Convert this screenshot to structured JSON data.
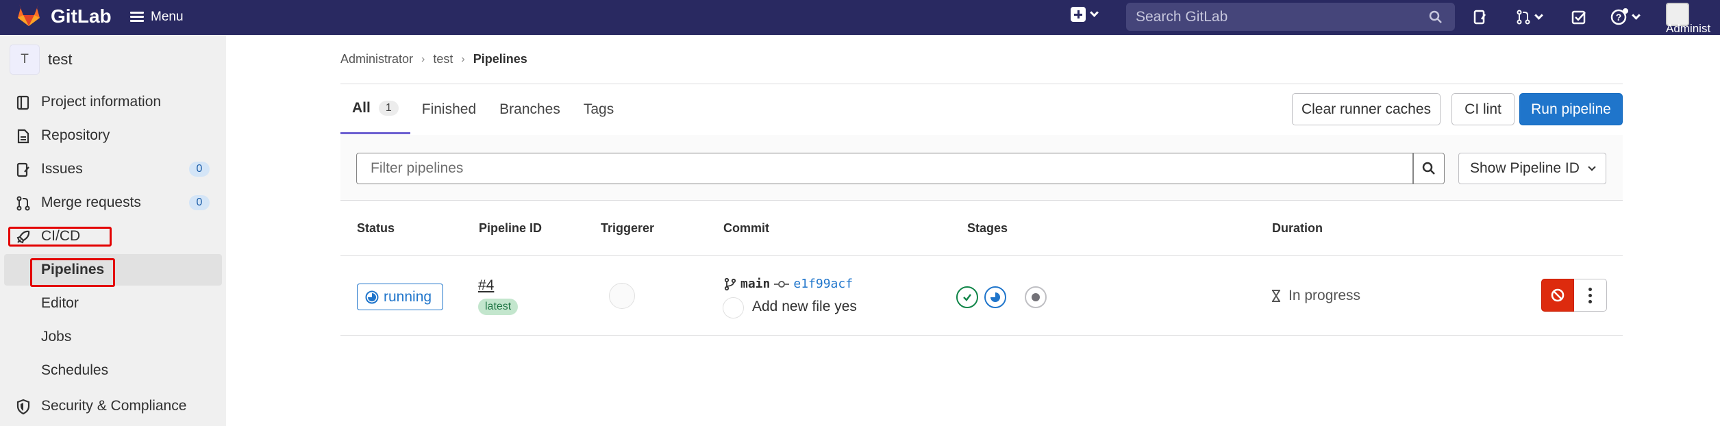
{
  "topbar": {
    "brand": "GitLab",
    "menu_label": "Menu",
    "search_placeholder": "Search GitLab",
    "avatar_label": "Administ"
  },
  "sidebar": {
    "project_initial": "T",
    "project_name": "test",
    "items": [
      {
        "label": "Project information",
        "icon": "book-icon"
      },
      {
        "label": "Repository",
        "icon": "document-icon"
      },
      {
        "label": "Issues",
        "icon": "issues-icon",
        "count": "0"
      },
      {
        "label": "Merge requests",
        "icon": "merge-request-icon",
        "count": "0"
      },
      {
        "label": "CI/CD",
        "icon": "rocket-icon"
      },
      {
        "label": "Security & Compliance",
        "icon": "shield-icon"
      }
    ],
    "cicd_sub": [
      {
        "label": "Pipelines",
        "active": true
      },
      {
        "label": "Editor"
      },
      {
        "label": "Jobs"
      },
      {
        "label": "Schedules"
      }
    ]
  },
  "breadcrumb": {
    "items": [
      "Administrator",
      "test",
      "Pipelines"
    ]
  },
  "tabs": [
    {
      "label": "All",
      "count": "1",
      "active": true
    },
    {
      "label": "Finished"
    },
    {
      "label": "Branches"
    },
    {
      "label": "Tags"
    }
  ],
  "actions": {
    "clear_caches": "Clear runner caches",
    "ci_lint": "CI lint",
    "run_pipeline": "Run pipeline"
  },
  "filter": {
    "placeholder": "Filter pipelines",
    "select_label": "Show Pipeline ID"
  },
  "table": {
    "headers": [
      "Status",
      "Pipeline ID",
      "Triggerer",
      "Commit",
      "Stages",
      "Duration"
    ],
    "rows": [
      {
        "status": "running",
        "pipeline_id": "#4",
        "tag": "latest",
        "branch": "main",
        "sha": "e1f99acf",
        "message": "Add new file yes",
        "stages": [
          "success",
          "running",
          "created"
        ],
        "duration": "In progress"
      }
    ]
  },
  "colors": {
    "topbar": "#292961",
    "primary": "#1f75cb",
    "danger": "#dd2b0e",
    "success": "#108548",
    "highlight_box": "#e30000"
  }
}
